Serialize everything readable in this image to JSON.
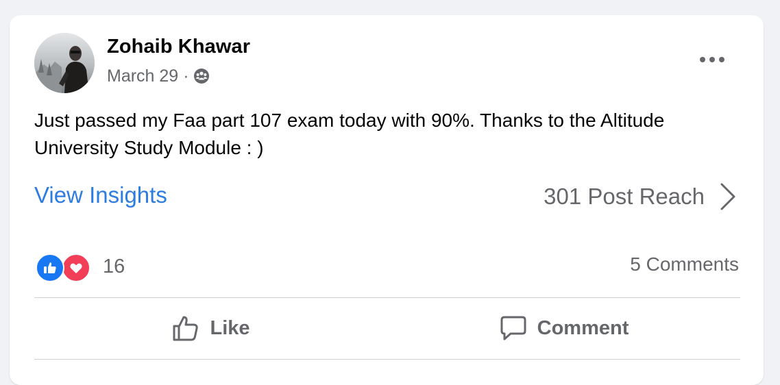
{
  "post": {
    "author": "Zohaib Khawar",
    "date": "March 29",
    "separator": "·",
    "audience_icon": "friends-icon",
    "more_icon": "more-options-icon",
    "text": "Just passed my Faa part 107 exam today with 90%. Thanks to the Altitude University Study Module : )"
  },
  "insights": {
    "link_label": "View Insights",
    "reach_label": "301 Post Reach",
    "chevron_icon": "chevron-right-icon"
  },
  "engagement": {
    "reaction_icons": [
      "like-reaction-icon",
      "love-reaction-icon"
    ],
    "reaction_count": "16",
    "comments_label": "5 Comments"
  },
  "actions": {
    "like_label": "Like",
    "like_icon": "thumbs-up-icon",
    "comment_label": "Comment",
    "comment_icon": "speech-bubble-icon"
  },
  "colors": {
    "link_blue": "#2D7CE0",
    "like_blue": "#1877F2",
    "love_red": "#F33E58",
    "secondary_text": "#65676B",
    "primary_text": "#050505",
    "page_background": "#F0F2F5"
  }
}
